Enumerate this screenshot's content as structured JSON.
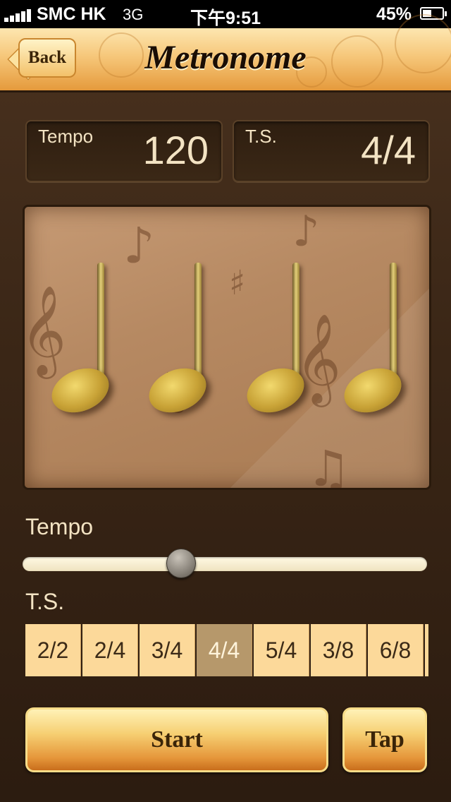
{
  "status_bar": {
    "carrier": "SMC HK",
    "network": "3G",
    "time": "下午9:51",
    "battery_percent_text": "45%",
    "battery_level": 0.45
  },
  "nav": {
    "back_label": "Back",
    "title": "Metronome"
  },
  "tempo_box": {
    "label": "Tempo",
    "value": "120"
  },
  "ts_box": {
    "label": "T.S.",
    "value": "4/4"
  },
  "beat_panel": {
    "beats": 4,
    "note_icon": "quarter-note-icon"
  },
  "tempo_section": {
    "label": "Tempo",
    "slider_fraction": 0.39
  },
  "ts_section": {
    "label": "T.S.",
    "options": [
      "2/2",
      "2/4",
      "3/4",
      "4/4",
      "5/4",
      "3/8",
      "6/8",
      ""
    ],
    "selected": "4/4"
  },
  "buttons": {
    "start_label": "Start",
    "tap_label": "Tap"
  },
  "colors": {
    "accent": "#e59a3c",
    "background": "#3a2616",
    "selected": "#b6986b",
    "text": "#f3e3c3"
  }
}
